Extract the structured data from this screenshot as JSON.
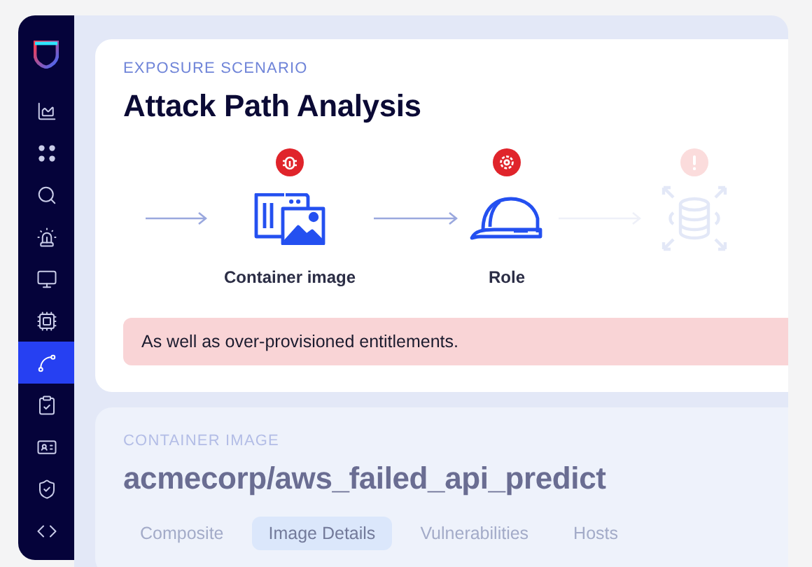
{
  "sidebar": {
    "items": [
      {
        "kind": "chart",
        "selected": false
      },
      {
        "kind": "dots",
        "selected": false
      },
      {
        "kind": "search",
        "selected": false
      },
      {
        "kind": "siren",
        "selected": false
      },
      {
        "kind": "monitor",
        "selected": false
      },
      {
        "kind": "chip",
        "selected": false
      },
      {
        "kind": "path",
        "selected": true
      },
      {
        "kind": "clipboard",
        "selected": false
      },
      {
        "kind": "card",
        "selected": false
      },
      {
        "kind": "shield",
        "selected": false
      },
      {
        "kind": "code",
        "selected": false
      }
    ]
  },
  "scenario": {
    "label": "EXPOSURE SCENARIO",
    "title": "Attack Path Analysis",
    "path": [
      {
        "kind": "image",
        "label": "Container image",
        "dimmed": false
      },
      {
        "kind": "role",
        "label": "Role",
        "dimmed": false
      },
      {
        "kind": "database",
        "dimmed": true
      }
    ],
    "alert": "As well as over-provisioned entitlements."
  },
  "details": {
    "label": "CONTAINER IMAGE",
    "title": "acmecorp/aws_failed_api_predict",
    "tabs": [
      {
        "label": "Composite",
        "selected": false
      },
      {
        "label": "Image Details",
        "selected": true
      },
      {
        "label": "Vulnerabilities",
        "selected": false
      },
      {
        "label": "Hosts",
        "selected": false
      }
    ]
  }
}
